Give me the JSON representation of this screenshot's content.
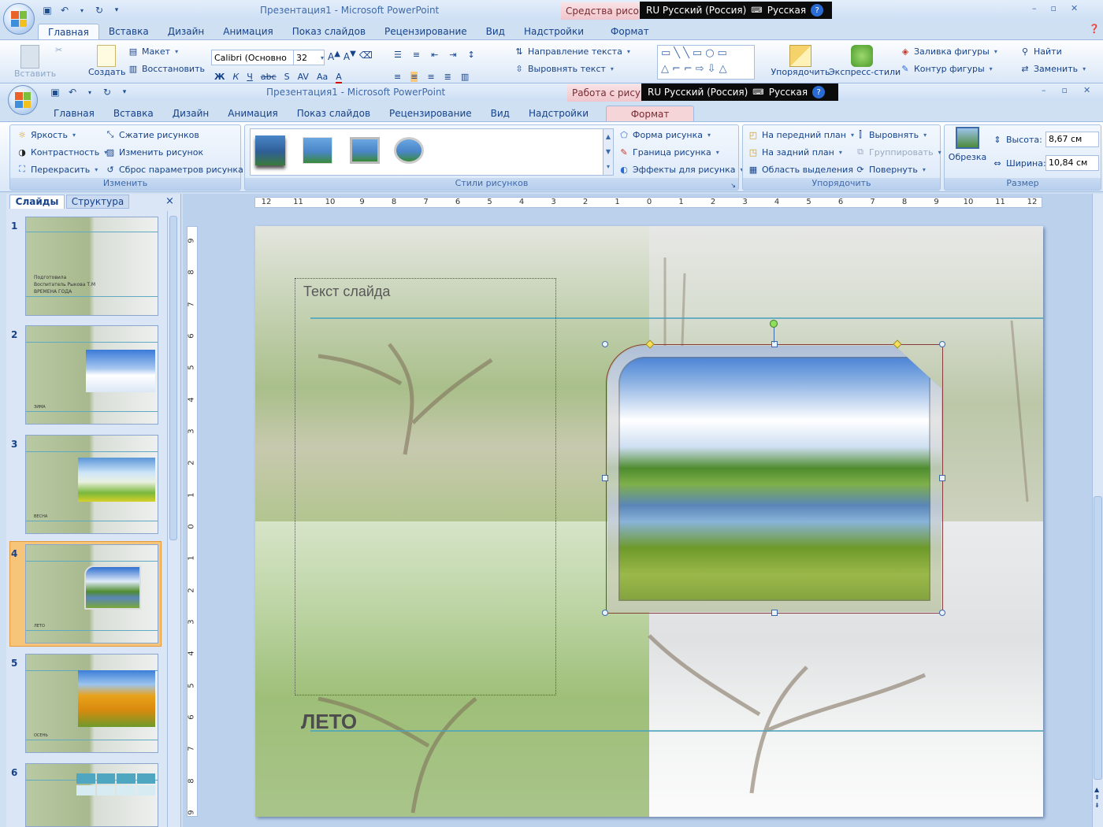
{
  "app": {
    "title": "Презентация1 - Microsoft PowerPoint",
    "back_context_tab": "Средства рисова",
    "front_context_tab": "Работа с рисунк"
  },
  "language_bar": {
    "lang": "RU Русский (Россия)",
    "keyboard": "Русская",
    "help": "?"
  },
  "back_ribbon": {
    "tabs": [
      "Главная",
      "Вставка",
      "Дизайн",
      "Анимация",
      "Показ слайдов",
      "Рецензирование",
      "Вид",
      "Надстройки",
      "Формат"
    ],
    "paste": "Вставить",
    "create": "Создать",
    "layout": "Макет",
    "restore": "Восстановить",
    "font_name": "Calibri (Основно",
    "font_size": "32",
    "text_direction": "Направление текста",
    "align_text": "Выровнять текст",
    "arrange": "Упорядочить",
    "quick_styles": "Экспресс-стили",
    "shape_fill": "Заливка фигуры",
    "shape_outline": "Контур фигуры",
    "find": "Найти",
    "replace": "Заменить"
  },
  "ribbon": {
    "tabs": [
      "Главная",
      "Вставка",
      "Дизайн",
      "Анимация",
      "Показ слайдов",
      "Рецензирование",
      "Вид",
      "Надстройки",
      "Формат"
    ],
    "active_tab": "Формат",
    "adjust": {
      "label": "Изменить",
      "brightness": "Яркость",
      "contrast": "Контрастность",
      "recolor": "Перекрасить",
      "compress": "Сжатие рисунков",
      "change": "Изменить рисунок",
      "reset": "Сброс параметров рисунка"
    },
    "styles": {
      "label": "Стили рисунков",
      "shape": "Форма рисунка",
      "border": "Граница рисунка",
      "effects": "Эффекты для рисунка"
    },
    "arrange": {
      "label": "Упорядочить",
      "front": "На передний план",
      "back": "На задний план",
      "selection": "Область выделения",
      "align": "Выровнять",
      "group": "Группировать",
      "rotate": "Повернуть"
    },
    "size": {
      "label": "Размер",
      "crop": "Обрезка",
      "height_label": "Высота:",
      "height": "8,67 см",
      "width_label": "Ширина:",
      "width": "10,84 см"
    }
  },
  "panel": {
    "tab_slides": "Слайды",
    "tab_outline": "Структура",
    "close": "×",
    "slides": [
      "1",
      "2",
      "3",
      "4",
      "5",
      "6"
    ],
    "selected": "4",
    "slide1_lines": [
      "Подготовила",
      "Воспитатель Рыкова Т.М",
      "ВРЕМЕНА ГОДА"
    ],
    "slide2_caption": "ЗИМА",
    "slide3_caption": "ВЕСНА",
    "slide4_caption": "ЛЕТО",
    "slide5_caption": "ОСЕНЬ"
  },
  "ruler": {
    "h_ticks": [
      "12",
      "11",
      "10",
      "9",
      "8",
      "7",
      "6",
      "5",
      "4",
      "3",
      "2",
      "1",
      "0",
      "1",
      "2",
      "3",
      "4",
      "5",
      "6",
      "7",
      "8",
      "9",
      "10",
      "11",
      "12"
    ],
    "v_ticks": [
      "9",
      "8",
      "7",
      "6",
      "5",
      "4",
      "3",
      "2",
      "1",
      "0",
      "1",
      "2",
      "3",
      "4",
      "5",
      "6",
      "7",
      "8",
      "9"
    ]
  },
  "slide": {
    "placeholder_text": "Текст слайда",
    "title": "ЛЕТО"
  },
  "colors": {
    "accent": "#15428b",
    "context_pink": "#f0c6cb",
    "selection_orange": "#f7a84a"
  }
}
